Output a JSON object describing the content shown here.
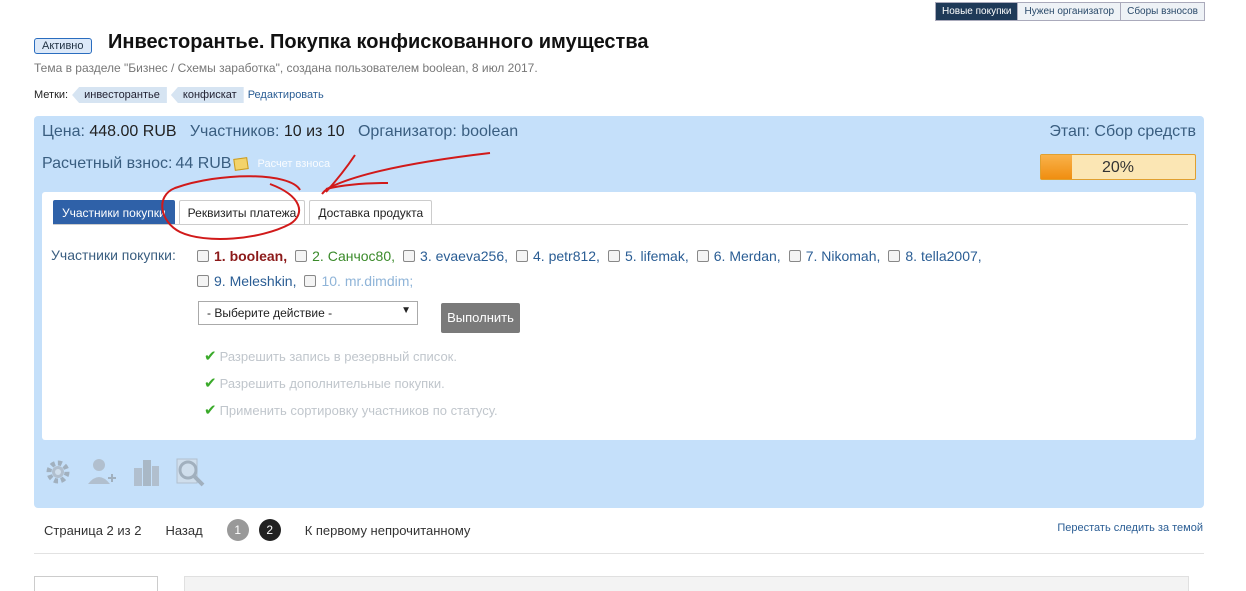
{
  "top_tabs": [
    {
      "label": "Новые покупки",
      "active": true
    },
    {
      "label": "Нужен организатор",
      "active": false
    },
    {
      "label": "Сборы взносов",
      "active": false
    }
  ],
  "header": {
    "status": "Активно",
    "title": "Инвесторантье. Покупка конфискованного имущества",
    "subtitle": "Тема в разделе \"Бизнес / Схемы заработка\", создана пользователем boolean, 8 июл 2017."
  },
  "tags": {
    "label": "Метки:",
    "items": [
      "инвесторантье",
      "конфискат"
    ],
    "edit": "Редактировать"
  },
  "info": {
    "price_label": "Цена:",
    "price": "448.00",
    "price_currency": "RUB",
    "participants_label": "Участников:",
    "participants": "10 из 10",
    "organizer_label": "Организатор:",
    "organizer": "boolean",
    "stage": "Этап: Сбор средств",
    "fee_label": "Расчетный взнос:",
    "fee": "44 RUB",
    "calc_link": "Расчет взноса",
    "progress_text": "20%",
    "progress_value": 0.2
  },
  "inner_tabs": [
    {
      "label": "Участники покупки",
      "active": true
    },
    {
      "label": "Реквизиты платежа",
      "active": false
    },
    {
      "label": "Доставка продукта",
      "active": false
    }
  ],
  "members": {
    "label": "Участники покупки:",
    "items": [
      {
        "text": "1. boolean,",
        "style": "first"
      },
      {
        "text": "2. Санчос80,",
        "style": "green"
      },
      {
        "text": "3. evaeva256,",
        "style": "normal"
      },
      {
        "text": "4. petr812,",
        "style": "normal"
      },
      {
        "text": "5. lifemak,",
        "style": "normal"
      },
      {
        "text": "6. Merdan,",
        "style": "normal"
      },
      {
        "text": "7. Nikomah,",
        "style": "normal"
      },
      {
        "text": "8. tella2007,",
        "style": "normal"
      },
      {
        "text": "9. Meleshkin,",
        "style": "normal"
      },
      {
        "text": "10. mr.dimdim;",
        "style": "light"
      }
    ]
  },
  "actions": {
    "select_value": "- Выберите действие -",
    "execute": "Выполнить"
  },
  "permissions": [
    "Разрешить запись в резервный список.",
    "Разрешить дополнительные покупки.",
    "Применить сортировку участников по статусу."
  ],
  "toolbar_icons": [
    "gear-icon",
    "add-user-icon",
    "building-icon",
    "magnifier-icon"
  ],
  "pager": {
    "page_text": "Страница 2 из 2",
    "back": "Назад",
    "pages": [
      "1",
      "2"
    ],
    "first_unread": "К первому непрочитанному",
    "unfollow": "Перестать следить за темой"
  },
  "colors": {
    "panel_bg": "#c5e0fa",
    "active_tab": "#2f61a8",
    "progress": "#f08e10",
    "annotation": "#d11a1a"
  }
}
